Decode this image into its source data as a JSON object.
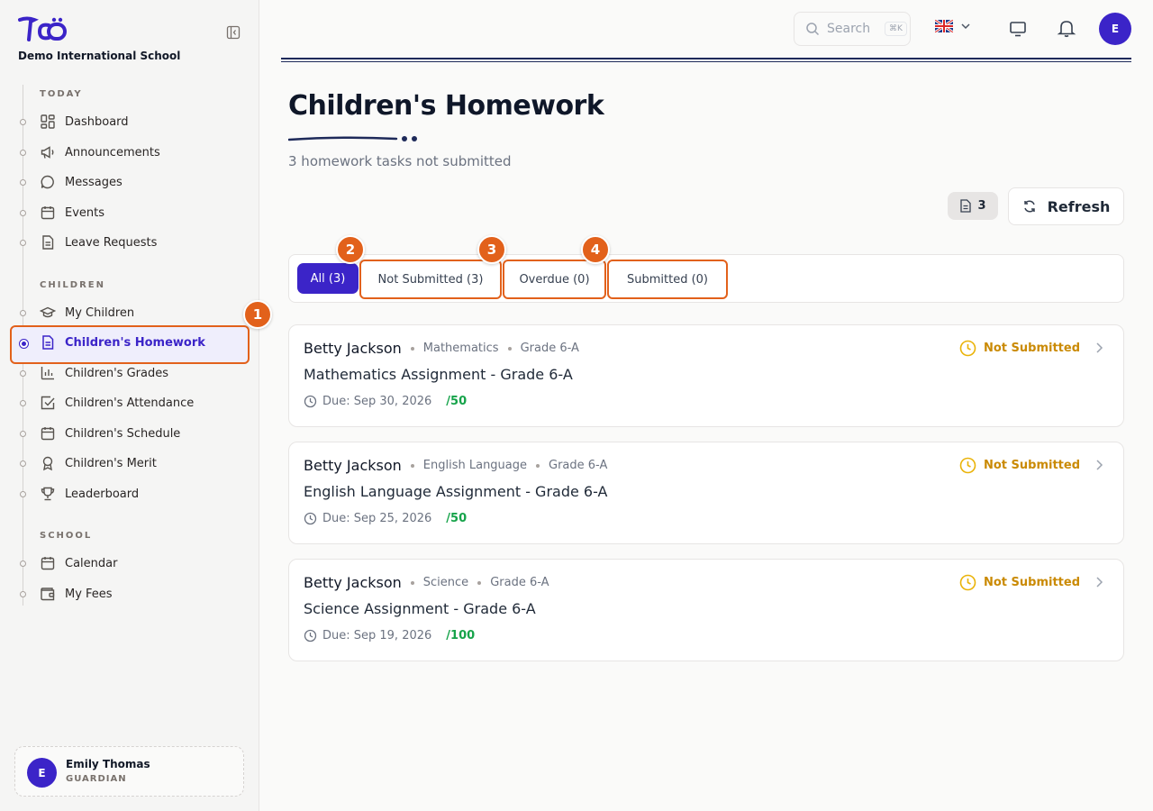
{
  "school": {
    "name": "Demo International School"
  },
  "sidebar": {
    "sections": [
      {
        "title": "TODAY"
      },
      {
        "title": "CHILDREN"
      },
      {
        "title": "SCHOOL"
      }
    ],
    "items": [
      {
        "label": "Dashboard",
        "icon": "dashboard-icon"
      },
      {
        "label": "Announcements",
        "icon": "megaphone-icon"
      },
      {
        "label": "Messages",
        "icon": "chat-icon"
      },
      {
        "label": "Events",
        "icon": "calendar-icon"
      },
      {
        "label": "Leave Requests",
        "icon": "document-icon"
      },
      {
        "label": "My Children",
        "icon": "graduation-cap-icon"
      },
      {
        "label": "Children's Homework",
        "icon": "document-icon",
        "active": true
      },
      {
        "label": "Children's Grades",
        "icon": "bar-chart-icon"
      },
      {
        "label": "Children's Attendance",
        "icon": "checkbox-icon"
      },
      {
        "label": "Children's Schedule",
        "icon": "calendar-icon"
      },
      {
        "label": "Children's Merit",
        "icon": "ribbon-icon"
      },
      {
        "label": "Leaderboard",
        "icon": "trophy-icon"
      },
      {
        "label": "Calendar",
        "icon": "calendar-icon"
      },
      {
        "label": "My Fees",
        "icon": "wallet-icon"
      }
    ]
  },
  "user": {
    "initial": "E",
    "name": "Emily Thomas",
    "role": "GUARDIAN"
  },
  "header": {
    "search_placeholder": "Search",
    "search_shortcut": "⌘K",
    "avatar_initial": "E"
  },
  "annotations": [
    "1",
    "2",
    "3",
    "4"
  ],
  "main": {
    "title": "Children's Homework",
    "subtitle": "3 homework tasks not submitted",
    "count": "3",
    "refresh_label": "Refresh"
  },
  "tabs": [
    {
      "label": "All (3)",
      "active": true
    },
    {
      "label": "Not Submitted (3)"
    },
    {
      "label": "Overdue (0)"
    },
    {
      "label": "Submitted (0)"
    }
  ],
  "homework": [
    {
      "student": "Betty Jackson",
      "subject": "Mathematics",
      "grade": "Grade 6-A",
      "title": "Mathematics Assignment - Grade 6-A",
      "due": "Due: Sep 30, 2026",
      "points": "/50",
      "status": "Not Submitted"
    },
    {
      "student": "Betty Jackson",
      "subject": "English Language",
      "grade": "Grade 6-A",
      "title": "English Language Assignment - Grade 6-A",
      "due": "Due: Sep 25, 2026",
      "points": "/50",
      "status": "Not Submitted"
    },
    {
      "student": "Betty Jackson",
      "subject": "Science",
      "grade": "Grade 6-A",
      "title": "Science Assignment - Grade 6-A",
      "due": "Due: Sep 19, 2026",
      "points": "/100",
      "status": "Not Submitted"
    }
  ],
  "colors": {
    "accent": "#3b24c8",
    "highlight": "#e2611b",
    "status_pending": "#ca8a04",
    "points": "#16a34a"
  }
}
